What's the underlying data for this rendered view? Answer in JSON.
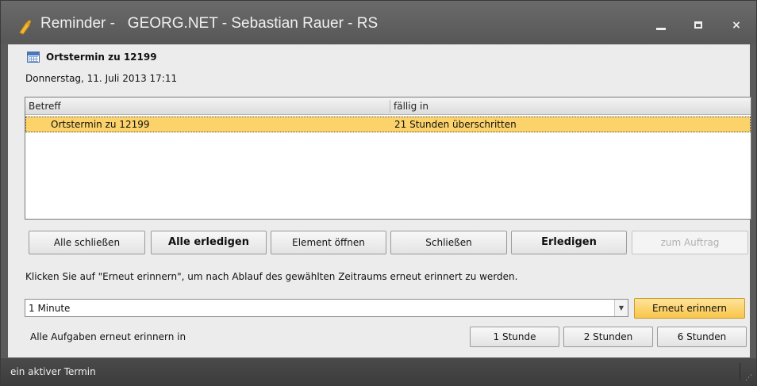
{
  "window": {
    "title": "Reminder -   GEORG.NET - Sebastian Rauer - RS",
    "minimize_label": "",
    "maximize_label": "",
    "close_label": "×"
  },
  "reminder": {
    "subject": "Ortstermin zu 12199",
    "datetime": "Donnerstag, 11. Juli 2013 17:11"
  },
  "list": {
    "columns": [
      "Betreff",
      "fällig in"
    ],
    "rows": [
      {
        "subject": "Ortstermin zu 12199",
        "due": "21 Stunden überschritten"
      }
    ]
  },
  "actions": {
    "close_all": "Alle schließen",
    "complete_all": "Alle erledigen",
    "open_item": "Element öffnen",
    "close": "Schließen",
    "complete": "Erledigen",
    "to_order": "zum Auftrag"
  },
  "hint": "Klicken Sie auf \"Erneut erinnern\", um nach Ablauf des gewählten Zeitraums erneut erinnert zu werden.",
  "snooze": {
    "selected": "1 Minute",
    "button": "Erneut erinnern",
    "all_label": "Alle Aufgaben erneut erinnern in",
    "one_hour": "1 Stunde",
    "two_hours": "2 Stunden",
    "six_hours": "6 Stunden"
  },
  "status": {
    "text": "ein aktiver Termin"
  },
  "colors": {
    "selected_row": "#fcd36a",
    "accent_button": "#f9c64a",
    "titlebar": "#5f5f5f"
  }
}
